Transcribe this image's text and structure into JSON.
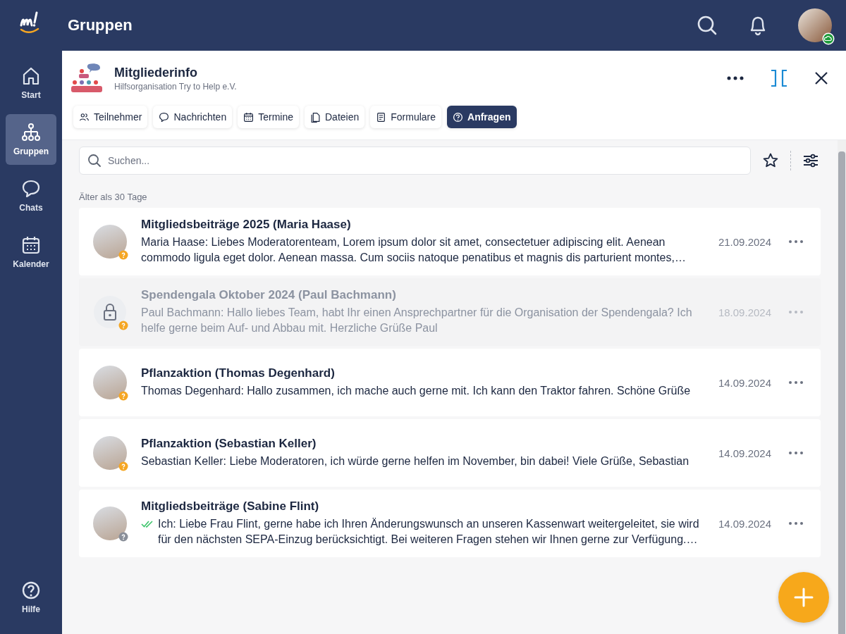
{
  "app": {
    "title": "Gruppen"
  },
  "sidebar": {
    "items": [
      {
        "label": "Start",
        "selected": false
      },
      {
        "label": "Gruppen",
        "selected": true
      },
      {
        "label": "Chats",
        "selected": false
      },
      {
        "label": "Kalender",
        "selected": false
      }
    ],
    "help": {
      "label": "Hilfe"
    }
  },
  "group": {
    "name": "Mitgliederinfo",
    "organization": "Hilfsorganisation Try to Help e.V."
  },
  "tabs": [
    {
      "label": "Teilnehmer",
      "selected": false
    },
    {
      "label": "Nachrichten",
      "selected": false
    },
    {
      "label": "Termine",
      "selected": false
    },
    {
      "label": "Dateien",
      "selected": false
    },
    {
      "label": "Formulare",
      "selected": false
    },
    {
      "label": "Anfragen",
      "selected": true
    }
  ],
  "search": {
    "placeholder": "Suchen..."
  },
  "section_label": "Älter als 30 Tage",
  "requests": [
    {
      "title": "Mitgliedsbeiträge 2025 (Maria Haase)",
      "text": "Maria Haase: Liebes Moderatorenteam, Lorem ipsum dolor sit amet, consectetuer adipiscing elit. Aenean commodo ligula eget dolor. Aenean massa. Cum sociis natoque penatibus et magnis dis parturient montes,…",
      "date": "21.09.2024",
      "disabled": false,
      "read_receipt": false,
      "color": "#f5a623"
    },
    {
      "title": "Spendengala Oktober 2024 (Paul Bachmann)",
      "text": "Paul Bachmann: Hallo liebes Team, habt Ihr einen Ansprechpartner für die Organisation der Spendengala? Ich helfe gerne beim Auf- und Abbau mit. Herzliche Grüße Paul",
      "date": "18.09.2024",
      "disabled": true,
      "read_receipt": false,
      "color": "#f5a623"
    },
    {
      "title": "Pflanzaktion (Thomas Degenhard)",
      "text": "Thomas Degenhard: Hallo zusammen, ich mache auch gerne mit. Ich kann den Traktor fahren. Schöne Grüße",
      "date": "14.09.2024",
      "disabled": false,
      "read_receipt": false,
      "color": "#f5a623"
    },
    {
      "title": "Pflanzaktion (Sebastian Keller)",
      "text": "Sebastian Keller: Liebe Moderatoren, ich würde gerne helfen im November, bin dabei! Viele Grüße, Sebastian",
      "date": "14.09.2024",
      "disabled": false,
      "read_receipt": false,
      "color": "#f5a623"
    },
    {
      "title": "Mitgliedsbeiträge (Sabine Flint)",
      "text": "Ich: Liebe Frau Flint,  gerne habe ich Ihren Änderungswunsch an unseren Kassenwart weitergeleitet, sie wird für den nächsten SEPA-Einzug berücksichtigt. Bei weiteren Fragen stehen wir Ihnen gerne zur Verfügung.…",
      "date": "14.09.2024",
      "disabled": false,
      "read_receipt": true,
      "color": "#8a8f99"
    }
  ]
}
